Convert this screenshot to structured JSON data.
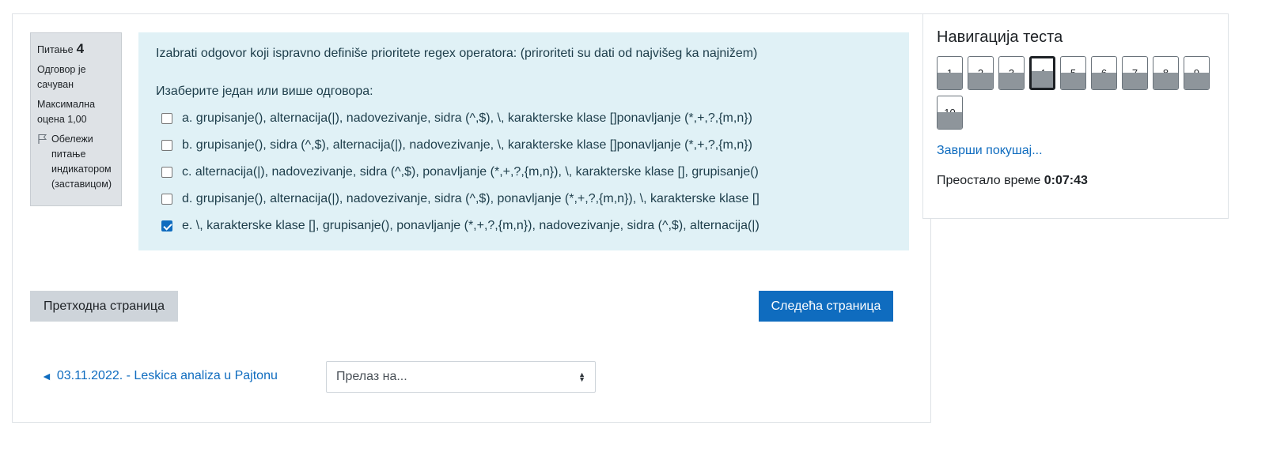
{
  "question_info": {
    "label": "Питање",
    "number": "4",
    "status": "Одговор је сачуван",
    "max_grade": "Максимална оцена 1,00",
    "flag_label": "Обележи питање индикатором (заставицом)"
  },
  "question": {
    "text": "Izabrati odgovor koji ispravno definiše prioritete regex operatora: (priroriteti su dati od najvišeg ka najnižem)",
    "prompt": "Изаберите један или више одговора:",
    "answers": [
      {
        "label": "a. grupisanje(), alternacija(|), nadovezivanje, sidra (^,$), \\, karakterske klase []ponavljanje (*,+,?,{m,n})",
        "checked": false
      },
      {
        "label": "b. grupisanje(), sidra (^,$), alternacija(|), nadovezivanje, \\, karakterske klase []ponavljanje (*,+,?,{m,n})",
        "checked": false
      },
      {
        "label": "c. alternacija(|), nadovezivanje, sidra (^,$), ponavljanje (*,+,?,{m,n}), \\, karakterske klase [], grupisanje()",
        "checked": false
      },
      {
        "label": "d. grupisanje(), alternacija(|), nadovezivanje, sidra (^,$), ponavljanje (*,+,?,{m,n}), \\, karakterske klase []",
        "checked": false
      },
      {
        "label": "e. \\, karakterske klase [], grupisanje(), ponavljanje (*,+,?,{m,n}), nadovezivanje, sidra (^,$), alternacija(|)",
        "checked": true
      }
    ]
  },
  "buttons": {
    "prev": "Претходна страница",
    "next": "Следећа страница"
  },
  "footer": {
    "prev_activity": "03.11.2022. - Leskica analiza u Pajtonu",
    "jump_select": "Прелаз на..."
  },
  "navigation": {
    "title": "Навигација теста",
    "questions": [
      "1",
      "2",
      "3",
      "4",
      "5",
      "6",
      "7",
      "8",
      "9",
      "10"
    ],
    "current": "4",
    "finish_link": "Заврши покушај...",
    "time_label": "Преостало време",
    "time_value": "0:07:43"
  },
  "colors": {
    "accent": "#0f6cbf",
    "question_bg": "#e0f1f6",
    "info_bg": "#dee2e6"
  },
  "icons": {
    "flag": "flag-icon",
    "arrow": "arrow-left-icon",
    "select": "chevron-updown-icon"
  }
}
